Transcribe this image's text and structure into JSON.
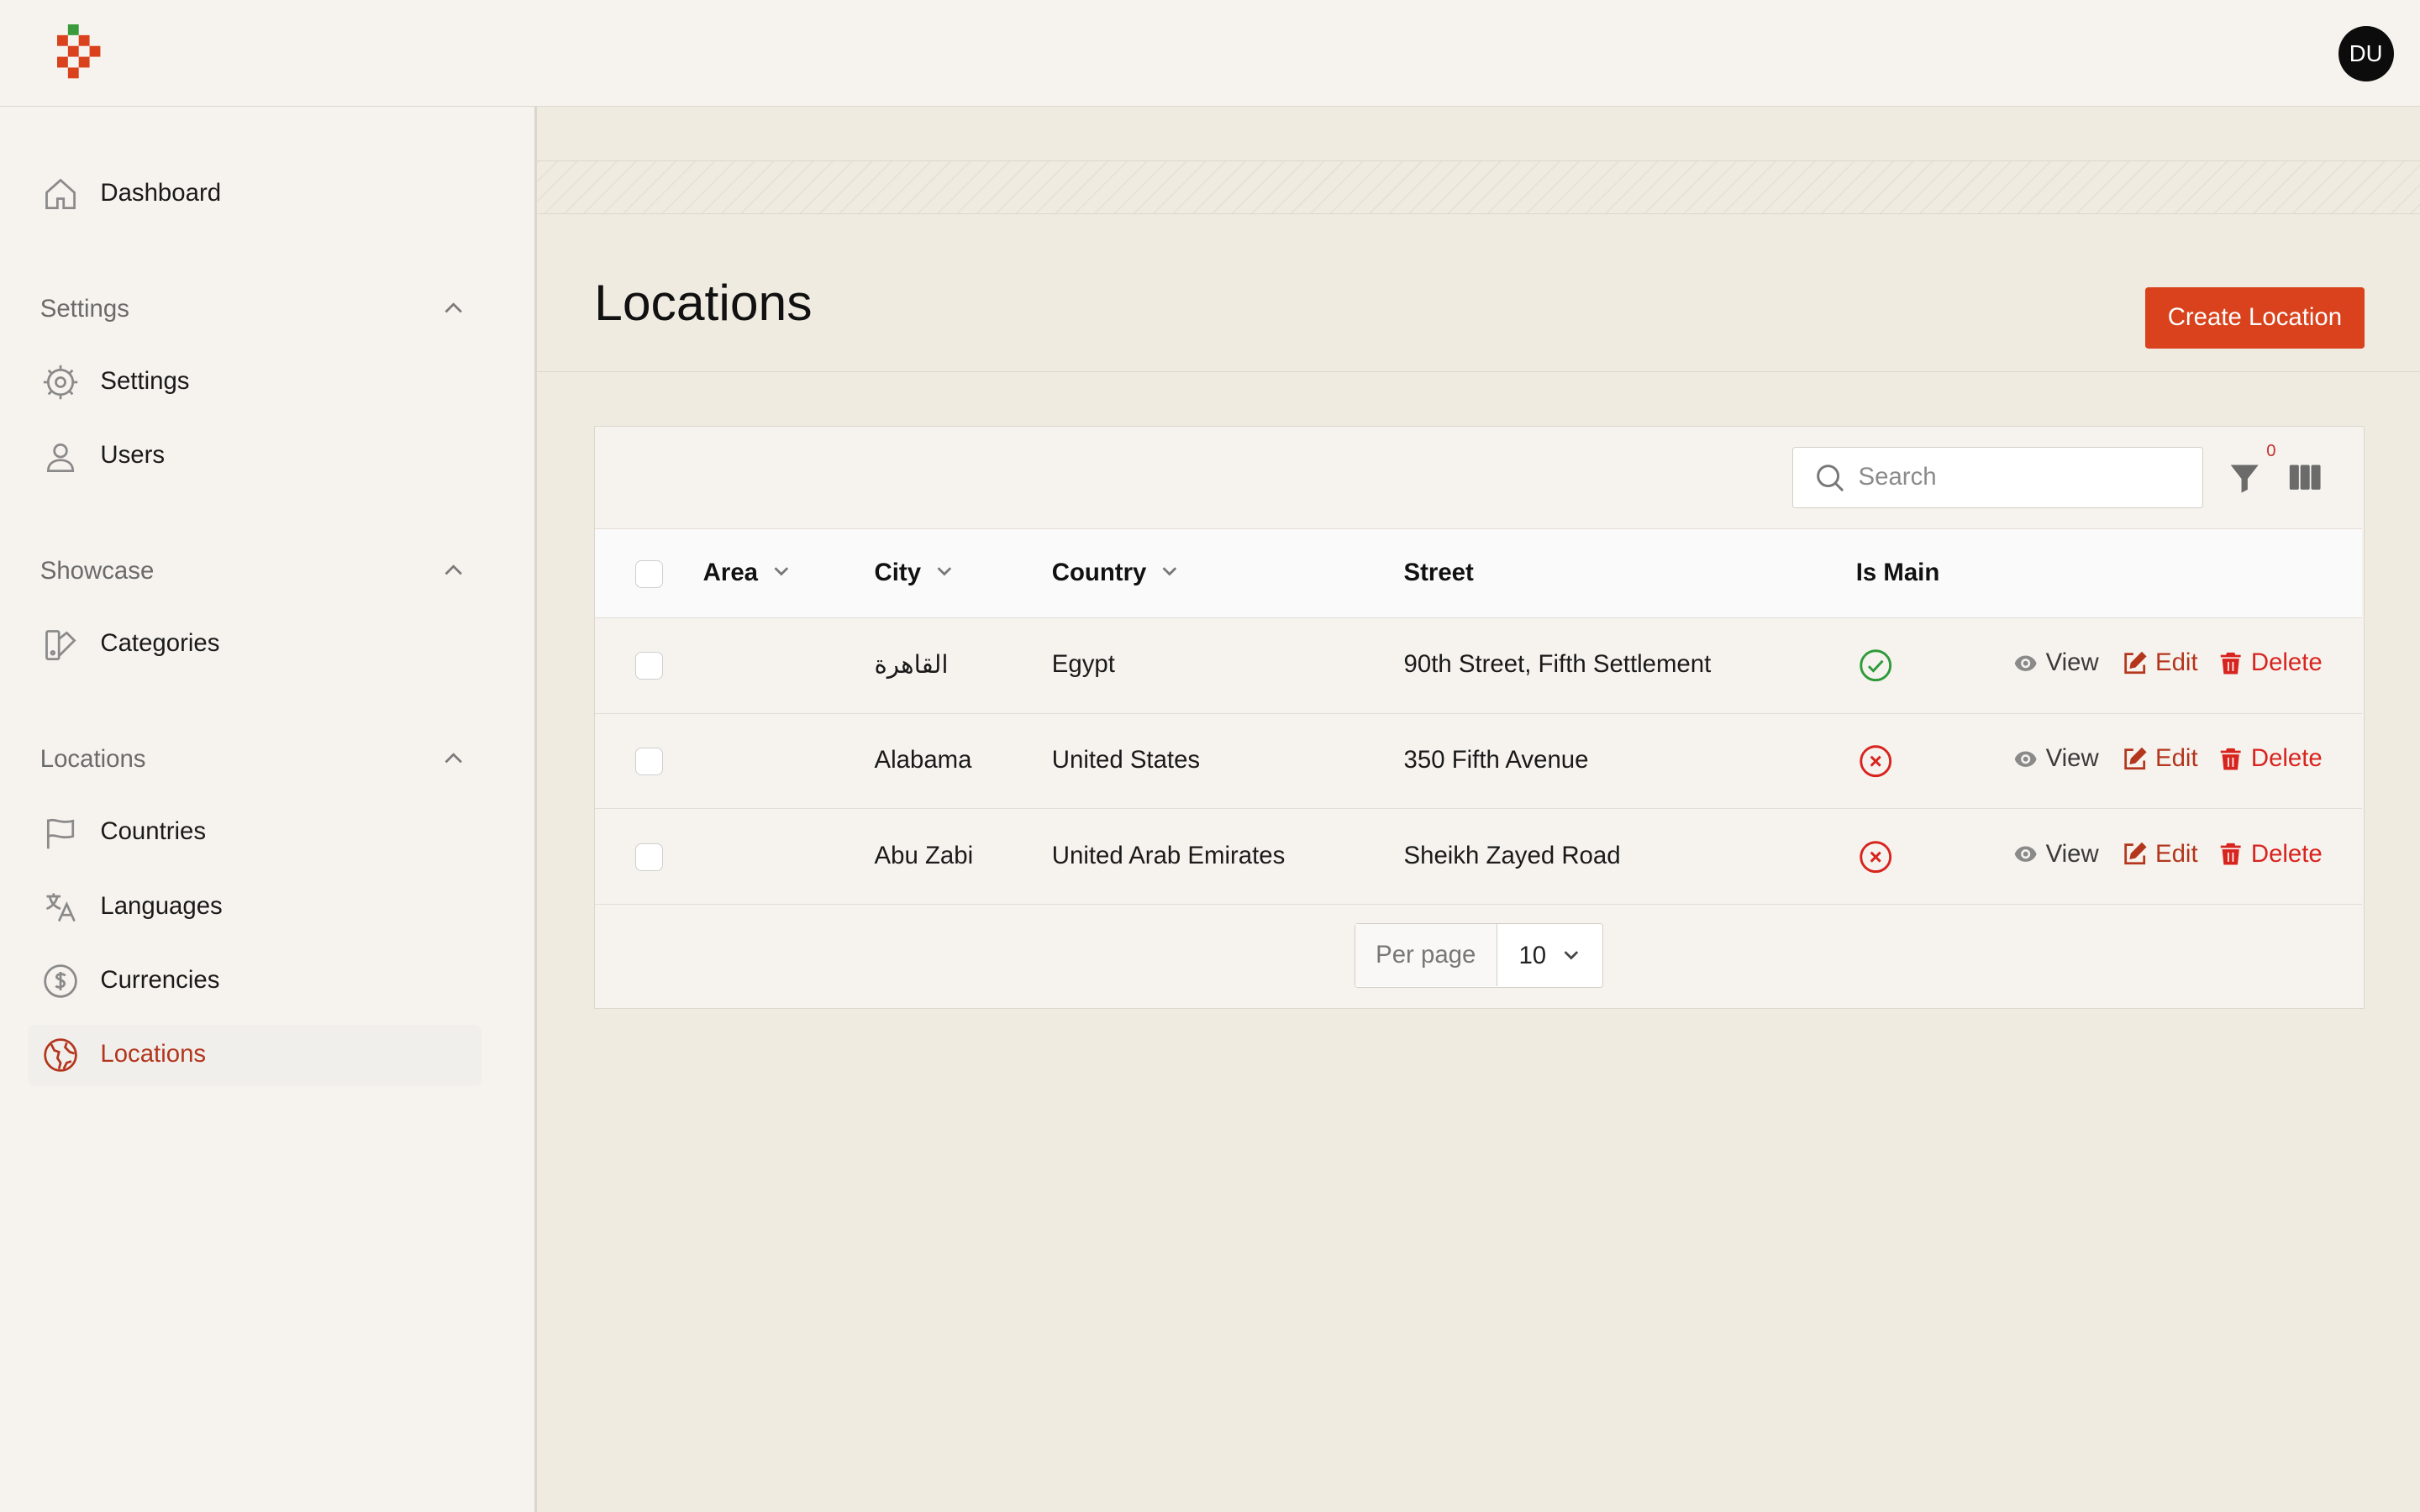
{
  "header": {
    "avatar_initials": "DU"
  },
  "sidebar": {
    "dashboard": {
      "label": "Dashboard",
      "icon": "home-icon"
    },
    "groups": [
      {
        "label": "Settings",
        "items": [
          {
            "label": "Settings",
            "icon": "gear-icon"
          },
          {
            "label": "Users",
            "icon": "user-icon"
          }
        ]
      },
      {
        "label": "Showcase",
        "items": [
          {
            "label": "Categories",
            "icon": "swatch-icon"
          }
        ]
      },
      {
        "label": "Locations",
        "items": [
          {
            "label": "Countries",
            "icon": "flag-icon"
          },
          {
            "label": "Languages",
            "icon": "translate-icon"
          },
          {
            "label": "Currencies",
            "icon": "dollar-icon"
          },
          {
            "label": "Locations",
            "icon": "globe-icon",
            "active": true
          }
        ]
      }
    ]
  },
  "page": {
    "title": "Locations",
    "create_button": "Create Location"
  },
  "table": {
    "search_placeholder": "Search",
    "filter_count": "0",
    "columns": [
      "Area",
      "City",
      "Country",
      "Street",
      "Is Main"
    ],
    "rows": [
      {
        "area": "",
        "city": "القاهرة",
        "country": "Egypt",
        "street": "90th Street, Fifth Settlement",
        "is_main": true
      },
      {
        "area": "",
        "city": "Alabama",
        "country": "United States",
        "street": "350 Fifth Avenue",
        "is_main": false
      },
      {
        "area": "",
        "city": "Abu Zabi",
        "country": "United Arab Emirates",
        "street": "Sheikh Zayed Road",
        "is_main": false
      }
    ],
    "actions": {
      "view": "View",
      "edit": "Edit",
      "delete": "Delete"
    },
    "per_page_label": "Per page",
    "per_page_value": "10"
  },
  "colors": {
    "accent": "#d9421c",
    "active_text": "#b3361d",
    "delete": "#d8241f",
    "success": "#2e9b3a",
    "error": "#d8241f"
  }
}
